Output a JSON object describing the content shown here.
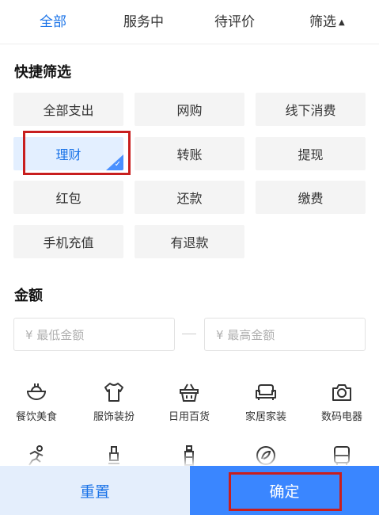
{
  "tabs": [
    {
      "label": "全部",
      "active": true
    },
    {
      "label": "服务中",
      "active": false
    },
    {
      "label": "待评价",
      "active": false
    },
    {
      "label": "筛选",
      "active": false
    }
  ],
  "quick_filter": {
    "title": "快捷筛选",
    "options": [
      {
        "label": "全部支出",
        "selected": false
      },
      {
        "label": "网购",
        "selected": false
      },
      {
        "label": "线下消费",
        "selected": false
      },
      {
        "label": "理财",
        "selected": true
      },
      {
        "label": "转账",
        "selected": false
      },
      {
        "label": "提现",
        "selected": false
      },
      {
        "label": "红包",
        "selected": false
      },
      {
        "label": "还款",
        "selected": false
      },
      {
        "label": "缴费",
        "selected": false
      },
      {
        "label": "手机充值",
        "selected": false
      },
      {
        "label": "有退款",
        "selected": false
      }
    ]
  },
  "amount": {
    "title": "金额",
    "min_placeholder": "¥ 最低金额",
    "max_placeholder": "¥ 最高金额"
  },
  "categories": [
    {
      "label": "餐饮美食",
      "icon": "bowl-icon"
    },
    {
      "label": "服饰装扮",
      "icon": "shirt-icon"
    },
    {
      "label": "日用百货",
      "icon": "basket-icon"
    },
    {
      "label": "家居家装",
      "icon": "sofa-icon"
    },
    {
      "label": "数码电器",
      "icon": "camera-icon"
    }
  ],
  "categories_row2_icons": [
    "runner-icon",
    "stroller-icon",
    "bottle-icon",
    "leaf-icon",
    "bus-icon"
  ],
  "buttons": {
    "reset": "重置",
    "confirm": "确定"
  },
  "colors": {
    "accent": "#1a73e8",
    "confirm_bg": "#3a86ff",
    "reset_bg": "#e4eefc",
    "highlight": "#c81e1e"
  }
}
